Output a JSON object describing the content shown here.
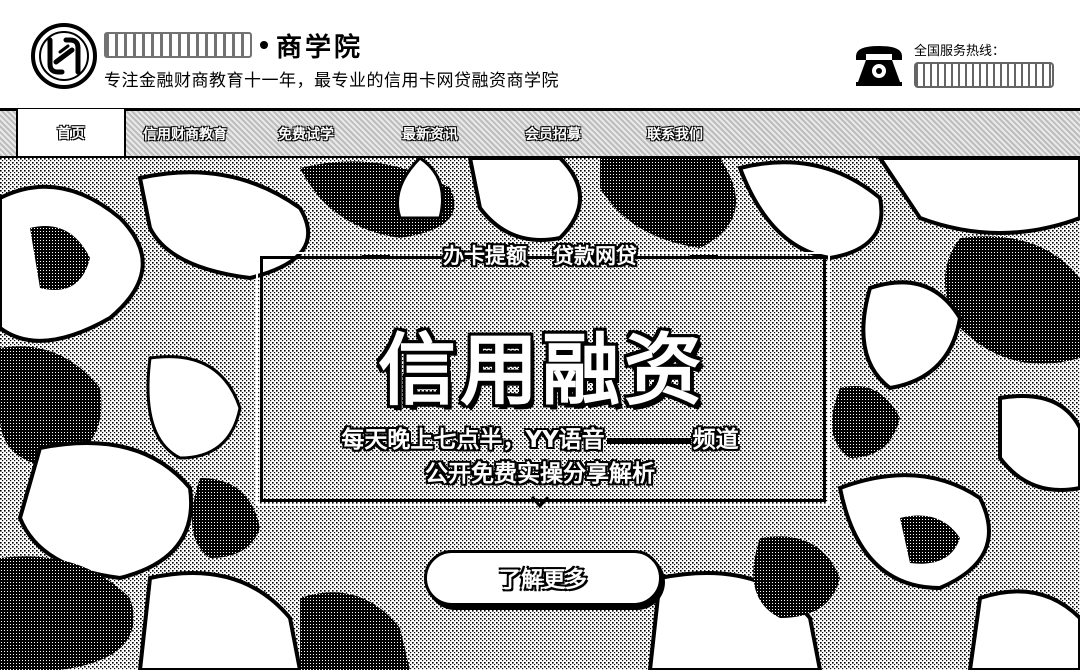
{
  "header": {
    "brand_title": "商学院",
    "tagline": "专注金融财商教育十一年，最专业的信用卡网贷融资商学院",
    "hotline_label": "全国服务热线："
  },
  "nav": {
    "items": [
      {
        "label": "首页",
        "active": true
      },
      {
        "label": "信用财商教育",
        "active": false
      },
      {
        "label": "免费试学",
        "active": false
      },
      {
        "label": "最新资讯",
        "active": false
      },
      {
        "label": "会员招募",
        "active": false
      },
      {
        "label": "联系我们",
        "active": false
      }
    ]
  },
  "hero": {
    "tag_left": "办卡提额",
    "tag_right": "贷款网贷",
    "headline": "信用融资",
    "sub_line1_a": "每天晚上七点半，YY语音",
    "sub_line1_b": "频道",
    "sub_line2": "公开免费实操分享解析",
    "cta_label": "了解更多"
  },
  "icons": {
    "logo": "logo-mark-icon",
    "phone": "telephone-icon",
    "scroll": "chevron-down-icon"
  }
}
